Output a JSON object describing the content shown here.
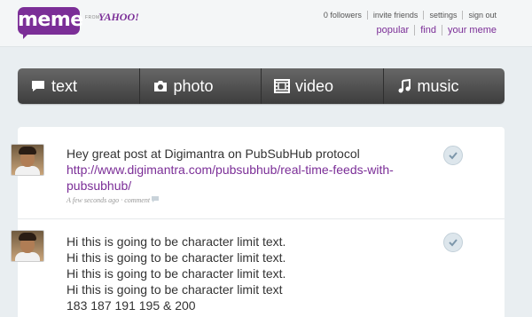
{
  "brand": {
    "logo": "meme",
    "from": "FROM",
    "partner": "YAHOO!"
  },
  "header": {
    "top_links": [
      "0 followers",
      "invite friends",
      "settings",
      "sign out"
    ],
    "main_links": [
      "popular",
      "find",
      "your meme"
    ]
  },
  "tabs": [
    {
      "label": "text",
      "icon": "speech-bubble-icon"
    },
    {
      "label": "photo",
      "icon": "camera-icon"
    },
    {
      "label": "video",
      "icon": "film-icon"
    },
    {
      "label": "music",
      "icon": "music-note-icon"
    }
  ],
  "posts": [
    {
      "text": "Hey great post at Digimantra on PubSubHub protocol",
      "link": "http://www.digimantra.com/pubsubhub/real-time-feeds-with-pubsubhub/",
      "time": "A few seconds ago",
      "comment": "comment"
    },
    {
      "lines": [
        "Hi this is going to be character limit text.",
        "Hi this is going to be character limit text.",
        "Hi this is going to be character limit text.",
        "Hi this is going to be character limit text",
        "183 187 191 195 & 200"
      ]
    }
  ],
  "colors": {
    "brand": "#7b2e97",
    "toolbar": "#4a4a4a",
    "background": "#e9eef1"
  }
}
